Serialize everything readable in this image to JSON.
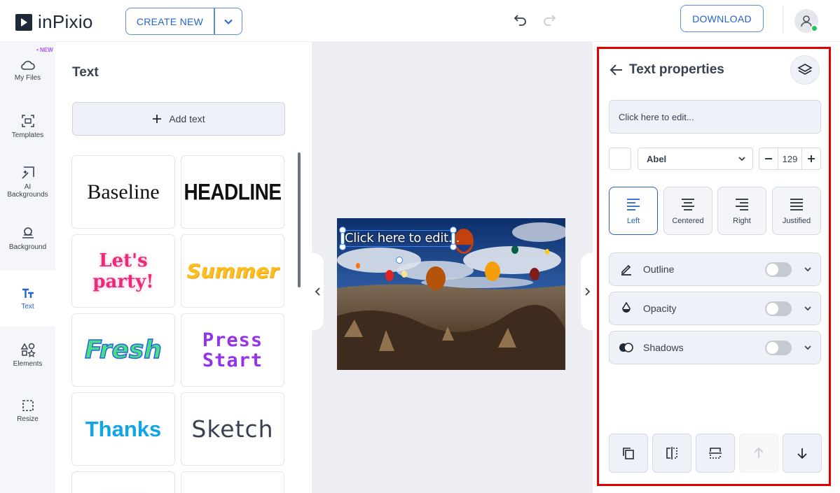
{
  "app": {
    "name": "inPixio"
  },
  "topbar": {
    "create_new_label": "CREATE NEW",
    "download_label": "DOWNLOAD"
  },
  "rail": {
    "new_badge": "• NEW",
    "items": [
      {
        "label": "My Files",
        "icon": "cloud-icon"
      },
      {
        "label": "Templates",
        "icon": "templates-icon"
      },
      {
        "label": "AI Backgrounds",
        "icon": "ai-backgrounds-icon"
      },
      {
        "label": "Background",
        "icon": "background-icon"
      },
      {
        "label": "Text",
        "icon": "text-icon",
        "active": true
      },
      {
        "label": "Elements",
        "icon": "elements-icon"
      },
      {
        "label": "Resize",
        "icon": "resize-icon"
      }
    ]
  },
  "text_panel": {
    "title": "Text",
    "add_text_label": "Add text",
    "tiles": [
      "Baseline",
      "HEADLINE",
      "Let's party!",
      "Summer",
      "Fresh",
      "Press Start",
      "Thanks",
      "Sketch"
    ]
  },
  "canvas": {
    "selected_text": "Click here to edit..."
  },
  "properties": {
    "title": "Text properties",
    "text_value": "Click here to edit...",
    "font": "Abel",
    "font_size": "129",
    "alignments": [
      {
        "label": "Left",
        "active": true
      },
      {
        "label": "Centered"
      },
      {
        "label": "Right"
      },
      {
        "label": "Justified"
      }
    ],
    "toggles": [
      {
        "label": "Outline",
        "on": false
      },
      {
        "label": "Opacity",
        "on": false
      },
      {
        "label": "Shadows",
        "on": false
      }
    ]
  },
  "colors": {
    "accent": "#2563c9",
    "highlight_frame": "#e00000"
  }
}
